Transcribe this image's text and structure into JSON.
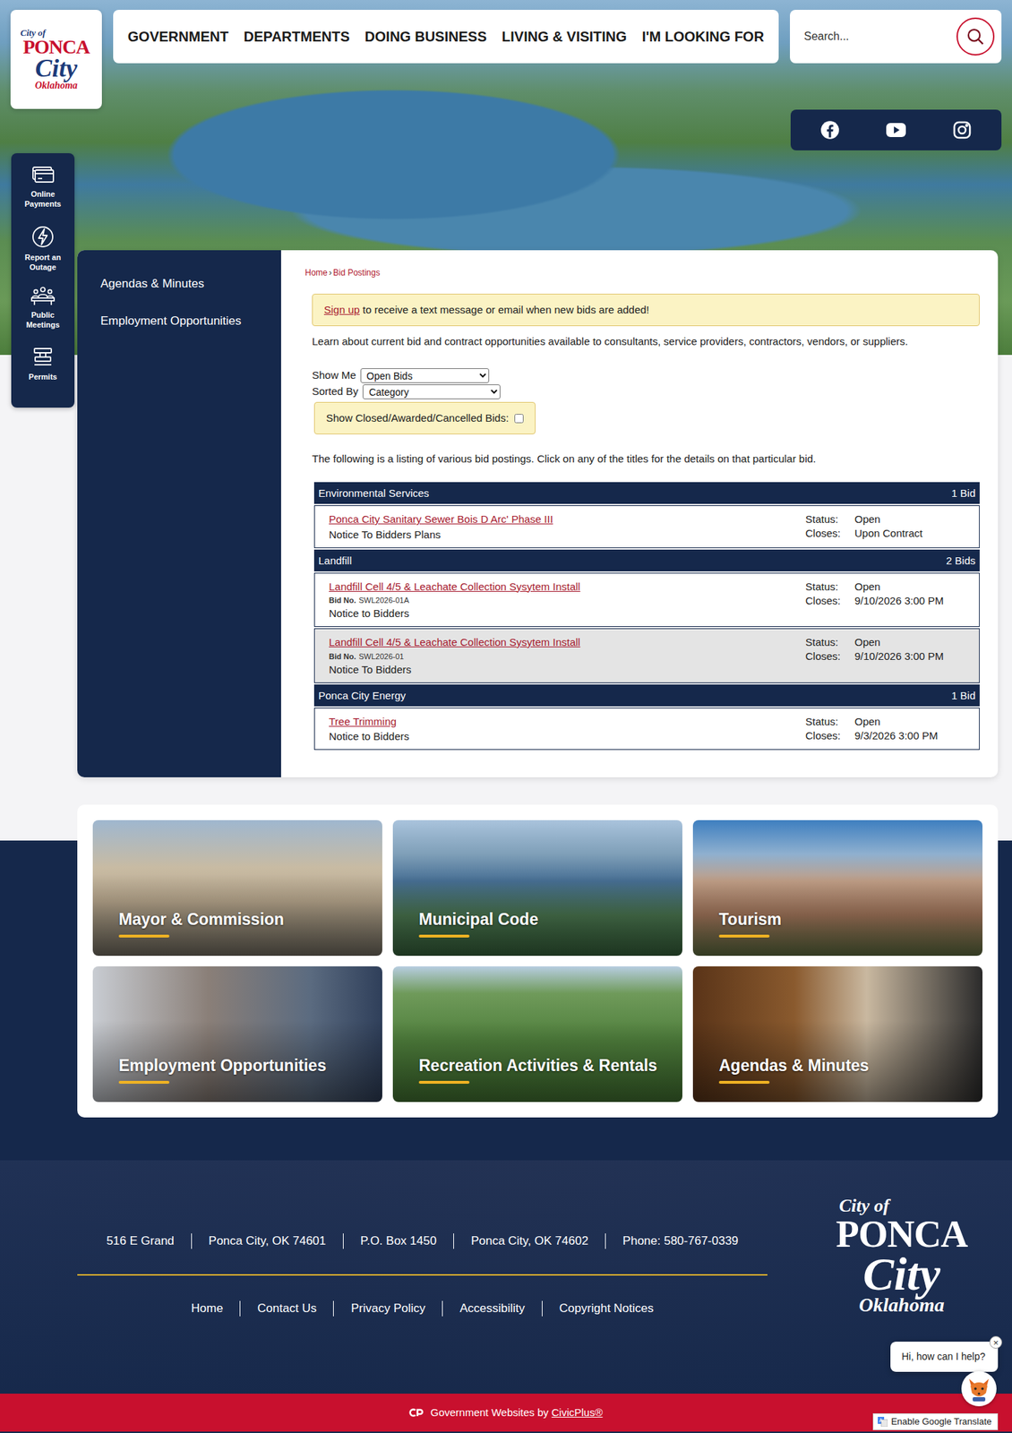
{
  "header": {
    "logo": {
      "top": "City of",
      "main": "PONCA",
      "script": "City",
      "bottom": "Oklahoma"
    },
    "nav": [
      "GOVERNMENT",
      "DEPARTMENTS",
      "DOING BUSINESS",
      "LIVING & VISITING",
      "I'M LOOKING FOR"
    ],
    "search": {
      "placeholder": "Search..."
    }
  },
  "quick_links": [
    "Online Payments",
    "Report an Outage",
    "Public Meetings",
    "Permits"
  ],
  "sidebar": {
    "items": [
      "Agendas & Minutes",
      "Employment Opportunities"
    ]
  },
  "breadcrumb": {
    "home": "Home",
    "separator": "›",
    "current": "Bid Postings"
  },
  "notice": {
    "link": "Sign up",
    "text": "to receive a text message or email when new bids are added!"
  },
  "intro": "Learn about current bid and contract opportunities available to consultants, service providers, contractors, vendors, or suppliers.",
  "filters": [
    {
      "label": "Show Me",
      "value": "Open Bids"
    },
    {
      "label": "Sorted By",
      "value": "Category"
    }
  ],
  "show_closed": {
    "label": "Show Closed/Awarded/Cancelled Bids:",
    "checked": false
  },
  "listing_note": "The following is a listing of various bid postings. Click on any of the titles for the details on that particular bid.",
  "categories": [
    {
      "name": "Environmental Services",
      "count": "1 Bid",
      "bids": [
        {
          "title": "Ponca City Sanitary Sewer Bois D Arc' Phase III",
          "subtitle": "Notice To Bidders Plans",
          "status_label": "Status:",
          "status": "Open",
          "closes_label": "Closes:",
          "closes": "Upon Contract",
          "highlighted": false
        }
      ]
    },
    {
      "name": "Landfill",
      "count": "2 Bids",
      "bids": [
        {
          "title": "Landfill Cell 4/5 & Leachate Collection Sysytem Install",
          "bid_no_label": "Bid No.",
          "bid_no": "SWL2026-01A",
          "subtitle": "Notice to Bidders",
          "status_label": "Status:",
          "status": "Open",
          "closes_label": "Closes:",
          "closes": "9/10/2026 3:00 PM",
          "highlighted": false
        },
        {
          "title": "Landfill Cell 4/5 & Leachate Collection Sysytem Install",
          "bid_no_label": "Bid No.",
          "bid_no": "SWL2026-01",
          "subtitle": "Notice To Bidders",
          "status_label": "Status:",
          "status": "Open",
          "closes_label": "Closes:",
          "closes": "9/10/2026 3:00 PM",
          "highlighted": true
        }
      ]
    },
    {
      "name": "Ponca City Energy",
      "count": "1 Bid",
      "bids": [
        {
          "title": "Tree Trimming",
          "subtitle": "Notice to Bidders",
          "status_label": "Status:",
          "status": "Open",
          "closes_label": "Closes:",
          "closes": "9/3/2026 3:00 PM",
          "highlighted": false
        }
      ]
    }
  ],
  "tiles": [
    "Mayor & Commission",
    "Municipal Code",
    "Tourism",
    "Employment Opportunities",
    "Recreation Activities & Rentals",
    "Agendas & Minutes"
  ],
  "footer": {
    "address": [
      "516 E Grand",
      "Ponca City, OK 74601",
      "P.O. Box 1450",
      "Ponca City, OK 74602",
      "Phone: 580-767-0339"
    ],
    "links": [
      "Home",
      "Contact Us",
      "Privacy Policy",
      "Accessibility",
      "Copyright Notices"
    ],
    "logo": {
      "top": "City of",
      "main": "PONCA",
      "script": "City",
      "bottom": "Oklahoma"
    }
  },
  "chat": {
    "message": "Hi, how can I help?",
    "close": "×"
  },
  "credit": {
    "text": "Government Websites by",
    "link": "CivicPlus®"
  },
  "translate": {
    "label": "Enable Google Translate"
  }
}
